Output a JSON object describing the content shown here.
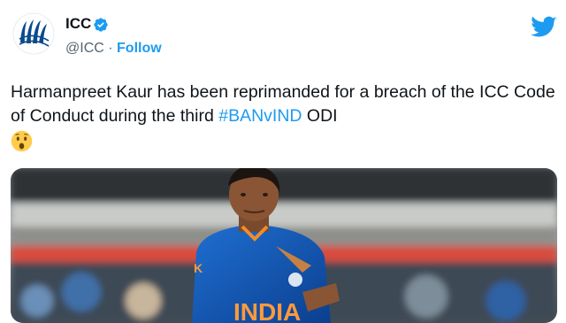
{
  "account": {
    "name": "ICC",
    "handle": "@ICC",
    "separator": "·",
    "follow_label": "Follow",
    "verified": true,
    "logo_icon": "icc-logo-icon"
  },
  "tweet": {
    "text_before": "Harmanpreet Kaur has been reprimanded for a breach of the ICC Code of Conduct during the third ",
    "hashtag": "#BANvIND",
    "text_after": " ODI",
    "emoji": "hushed-face-emoji"
  },
  "media": {
    "jersey_text": "INDIA",
    "jersey_small_text": "K"
  },
  "colors": {
    "link": "#1d9bf0",
    "text": "#0f1419",
    "secondary": "#536471",
    "brand_bird": "#1d9bf0"
  },
  "icons": [
    "icc-logo-icon",
    "verified-badge-icon",
    "twitter-bird-icon",
    "hushed-face-emoji"
  ]
}
